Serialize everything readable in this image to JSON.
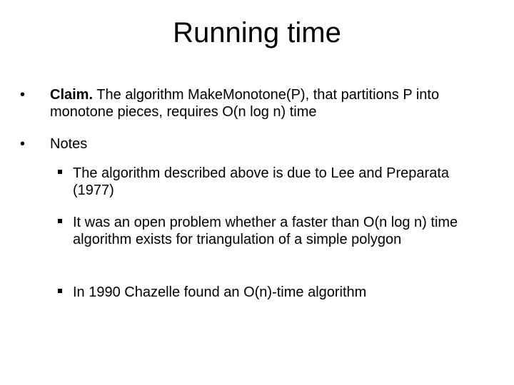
{
  "slide": {
    "title": "Running time",
    "bullets": [
      {
        "lead": "Claim.",
        "text": " The algorithm MakeMonotone(P), that partitions P into monotone pieces, requires O(n log n) time"
      },
      {
        "text": "Notes",
        "sub_bullets": [
          "The algorithm described above is due to Lee and Preparata (1977)",
          "It was an open problem whether a faster than O(n log n) time algorithm exists for triangulation of a simple polygon",
          "In 1990 Chazelle found an O(n)-time algorithm"
        ]
      }
    ],
    "bullet_glyph": "•",
    "sub_bullet_glyph": "▪"
  }
}
